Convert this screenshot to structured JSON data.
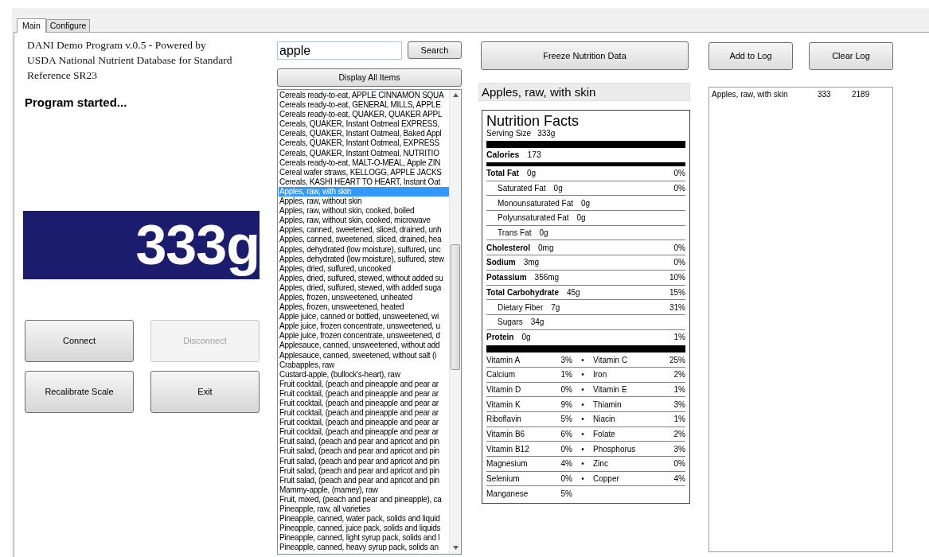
{
  "tabs": [
    {
      "label": "Main",
      "selected": true
    },
    {
      "label": "Configure",
      "selected": false
    }
  ],
  "title_text": "DANI Demo Program v.0.5 - Powered by USDA National Nutrient Database for Standard Reference SR23",
  "status_text": "Program started...",
  "scale_reading": "333g",
  "scale_buttons": [
    {
      "label": "Connect",
      "disabled": false
    },
    {
      "label": "Disconnect",
      "disabled": true
    },
    {
      "label": "Recalibrate Scale",
      "disabled": false
    },
    {
      "label": "Exit",
      "disabled": false
    }
  ],
  "search": {
    "value": "apple",
    "button": "Search",
    "display_all": "Display All Items"
  },
  "food_list": [
    {
      "text": "Cereals ready-to-eat, APPLE CINNAMON SQUA",
      "selected": false
    },
    {
      "text": "Cereals ready-to-eat, GENERAL MILLS, APPLE",
      "selected": false
    },
    {
      "text": "Cereals ready-to-eat, QUAKER, QUAKER APPL",
      "selected": false
    },
    {
      "text": "Cereals, QUAKER, Instant Oatmeal EXPRESS,",
      "selected": false
    },
    {
      "text": "Cereals, QUAKER, Instant Oatmeal, Baked Appl",
      "selected": false
    },
    {
      "text": "Cereals, QUAKER, Instant Oatmeal, EXPRESS",
      "selected": false
    },
    {
      "text": "Cereals, QUAKER, Instant Oatmeal, NUTRITIO",
      "selected": false
    },
    {
      "text": "Cereals ready-to-eat, MALT-O-MEAL, Apple ZIN",
      "selected": false
    },
    {
      "text": "Cereal wafer straws, KELLOGG, APPLE JACKS",
      "selected": false
    },
    {
      "text": "Cereals, KASHI HEART TO HEART, Instant Oat",
      "selected": false
    },
    {
      "text": "Apples, raw, with skin",
      "selected": true
    },
    {
      "text": "Apples, raw, without skin",
      "selected": false
    },
    {
      "text": "Apples, raw, without skin, cooked, boiled",
      "selected": false
    },
    {
      "text": "Apples, raw, without skin, cooked, microwave",
      "selected": false
    },
    {
      "text": "Apples, canned, sweetened, sliced, drained, unh",
      "selected": false
    },
    {
      "text": "Apples, canned, sweetened, sliced, drained, hea",
      "selected": false
    },
    {
      "text": "Apples, dehydrated (low moisture), sulfured, unc",
      "selected": false
    },
    {
      "text": "Apples, dehydrated (low moisture), sulfured, stew",
      "selected": false
    },
    {
      "text": "Apples, dried, sulfured, uncooked",
      "selected": false
    },
    {
      "text": "Apples, dried, sulfured, stewed, without added su",
      "selected": false
    },
    {
      "text": "Apples, dried, sulfured, stewed, with added suga",
      "selected": false
    },
    {
      "text": "Apples, frozen, unsweetened, unheated",
      "selected": false
    },
    {
      "text": "Apples, frozen, unsweetened, heated",
      "selected": false
    },
    {
      "text": "Apple juice, canned or bottled, unsweetened, wi",
      "selected": false
    },
    {
      "text": "Apple juice, frozen concentrate, unsweetened, u",
      "selected": false
    },
    {
      "text": "Apple juice, frozen concentrate, unsweetened, d",
      "selected": false
    },
    {
      "text": "Applesauce, canned, unsweetened, without add",
      "selected": false
    },
    {
      "text": "Applesauce, canned, sweetened, without salt (i",
      "selected": false
    },
    {
      "text": "Crabapples, raw",
      "selected": false
    },
    {
      "text": "Custard-apple, (bullock's-heart), raw",
      "selected": false
    },
    {
      "text": "Fruit cocktail, (peach and pineapple and pear ar",
      "selected": false
    },
    {
      "text": "Fruit cocktail, (peach and pineapple and pear ar",
      "selected": false
    },
    {
      "text": "Fruit cocktail, (peach and pineapple and pear ar",
      "selected": false
    },
    {
      "text": "Fruit cocktail, (peach and pineapple and pear ar",
      "selected": false
    },
    {
      "text": "Fruit cocktail, (peach and pineapple and pear ar",
      "selected": false
    },
    {
      "text": "Fruit cocktail, (peach and pineapple and pear ar",
      "selected": false
    },
    {
      "text": "Fruit salad, (peach and pear and apricot and pin",
      "selected": false
    },
    {
      "text": "Fruit salad, (peach and pear and apricot and pin",
      "selected": false
    },
    {
      "text": "Fruit salad, (peach and pear and apricot and pin",
      "selected": false
    },
    {
      "text": "Fruit salad, (peach and pear and apricot and pin",
      "selected": false
    },
    {
      "text": "Fruit salad, (peach and pear and apricot and pin",
      "selected": false
    },
    {
      "text": "Mammy-apple, (mamey), raw",
      "selected": false
    },
    {
      "text": "Fruit, mixed, (peach and pear and pineapple), ca",
      "selected": false
    },
    {
      "text": "Pineapple, raw, all varieties",
      "selected": false
    },
    {
      "text": "Pineapple, canned, water pack, solids and liquid",
      "selected": false
    },
    {
      "text": "Pineapple, canned, juice pack, solids and liquids",
      "selected": false
    },
    {
      "text": "Pineapple, canned, light syrup pack, solids and l",
      "selected": false
    },
    {
      "text": "Pineapple, canned, heavy syrup pack, solids an",
      "selected": false
    }
  ],
  "freeze_button": "Freeze Nutrition Data",
  "selected_food": "Apples, raw, with skin",
  "nutrition": {
    "title": "Nutrition Facts",
    "serving_label": "Serving Size",
    "serving_value": "333g",
    "calories_label": "Calories",
    "calories_value": "173",
    "rows": [
      {
        "kind": "main",
        "name": "Total Fat",
        "amount": "0g",
        "dv": "0%"
      },
      {
        "kind": "sub",
        "name": "Saturated Fat",
        "amount": "0g",
        "dv": "0%"
      },
      {
        "kind": "sub",
        "name": "Monounsaturated Fat",
        "amount": "0g"
      },
      {
        "kind": "sub",
        "name": "Polyunsaturated Fat",
        "amount": "0g"
      },
      {
        "kind": "sub",
        "name": "Trans Fat",
        "amount": "0g"
      },
      {
        "kind": "main",
        "name": "Cholesterol",
        "amount": "0mg",
        "dv": "0%"
      },
      {
        "kind": "main",
        "name": "Sodium",
        "amount": "3mg",
        "dv": "0%"
      },
      {
        "kind": "main",
        "name": "Potassium",
        "amount": "356mg",
        "dv": "10%"
      },
      {
        "kind": "main",
        "name": "Total Carbohydrate",
        "amount": "45g",
        "dv": "15%"
      },
      {
        "kind": "sub",
        "name": "Dietary Fiber",
        "amount": "7g",
        "dv": "31%"
      },
      {
        "kind": "sub",
        "name": "Sugars",
        "amount": "34g"
      },
      {
        "kind": "main",
        "name": "Protein",
        "amount": "0g",
        "dv": "1%"
      }
    ],
    "vitamins": [
      {
        "left": "Vitamin A",
        "left_pct": "3%",
        "bullet": "•",
        "right": "Vitamin C",
        "right_pct": "25%"
      },
      {
        "left": "Calcium",
        "left_pct": "1%",
        "bullet": "•",
        "right": "Iron",
        "right_pct": "2%"
      },
      {
        "left": "Vitamin D",
        "left_pct": "0%",
        "bullet": "•",
        "right": "Vitamin E",
        "right_pct": "1%"
      },
      {
        "left": "Vitamin K",
        "left_pct": "9%",
        "bullet": "•",
        "right": "Thiamin",
        "right_pct": "3%"
      },
      {
        "left": "Riboflavin",
        "left_pct": "5%",
        "bullet": "•",
        "right": "Niacin",
        "right_pct": "1%"
      },
      {
        "left": "Vitamin B6",
        "left_pct": "6%",
        "bullet": "•",
        "right": "Folate",
        "right_pct": "2%"
      },
      {
        "left": "Vitamin B12",
        "left_pct": "0%",
        "bullet": "•",
        "right": "Phosphorus",
        "right_pct": "3%"
      },
      {
        "left": "Magnesium",
        "left_pct": "4%",
        "bullet": "•",
        "right": "Zinc",
        "right_pct": "0%"
      },
      {
        "left": "Selenium",
        "left_pct": "0%",
        "bullet": "•",
        "right": "Copper",
        "right_pct": "4%"
      },
      {
        "left": "Manganese",
        "left_pct": "5%"
      }
    ]
  },
  "log_buttons": [
    "Add to Log",
    "Clear Log"
  ],
  "log": [
    {
      "food": "Apples, raw, with skin",
      "grams": "333",
      "value": "2189"
    }
  ]
}
